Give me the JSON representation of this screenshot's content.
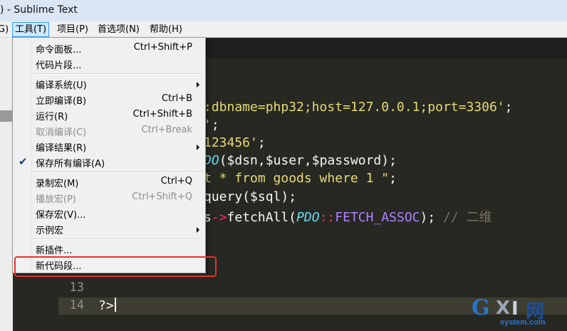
{
  "window": {
    "title": ") - Sublime Text"
  },
  "menubar": {
    "items": [
      {
        "label": "G)"
      },
      {
        "label": "工具(T)"
      },
      {
        "label": "项目(P)"
      },
      {
        "label": "首选项(N)"
      },
      {
        "label": "帮助(H)"
      }
    ]
  },
  "tools_menu": {
    "items": [
      {
        "label": "命令面板...",
        "shortcut": "Ctrl+Shift+P"
      },
      {
        "label": "代码片段...",
        "shortcut": ""
      },
      {
        "label": "编译系统(U)",
        "shortcut": ""
      },
      {
        "label": "立即编译(B)",
        "shortcut": "Ctrl+B"
      },
      {
        "label": "运行(R)",
        "shortcut": "Ctrl+Shift+B"
      },
      {
        "label": "取消编译(C)",
        "shortcut": "Ctrl+Break"
      },
      {
        "label": "编译结果(R)",
        "shortcut": ""
      },
      {
        "label": "保存所有编译(A)",
        "shortcut": ""
      },
      {
        "label": "录制宏(M)",
        "shortcut": "Ctrl+Q"
      },
      {
        "label": "播放宏(P)",
        "shortcut": "Ctrl+Shift+Q"
      },
      {
        "label": "保存宏(V)...",
        "shortcut": ""
      },
      {
        "label": "示例宏",
        "shortcut": ""
      },
      {
        "label": "新插件...",
        "shortcut": ""
      },
      {
        "label": "新代码段...",
        "shortcut": ""
      }
    ]
  },
  "editor": {
    "code": {
      "l1": ":dbname=php32;host=127.0.0.1;port=3306'",
      "l1_end": ";",
      "l2": "'",
      "l2_end": ";",
      "l3": "123456'",
      "l3_end": ";",
      "l4_cls": "DO",
      "l4_rest": "($dsn,$user,$password);",
      "l5_str": "t * from goods where 1 \"",
      "l5_end": ";",
      "l6": "query($sql);",
      "l7_a": "s",
      "l7_op": "->",
      "l7_b": "fetchAll(",
      "l7_cls": "PDO",
      "l7_op2": "::",
      "l7_const": "FETCH_ASSOC",
      "l7_c": ");",
      "l7_cmt": "// 二维",
      "l14": "?>"
    },
    "line_numbers": {
      "n13": "13",
      "n14": "14"
    }
  },
  "watermark": {
    "g": "G",
    "x": "X",
    "i": "I",
    "w": "网",
    "site": "system.com"
  }
}
